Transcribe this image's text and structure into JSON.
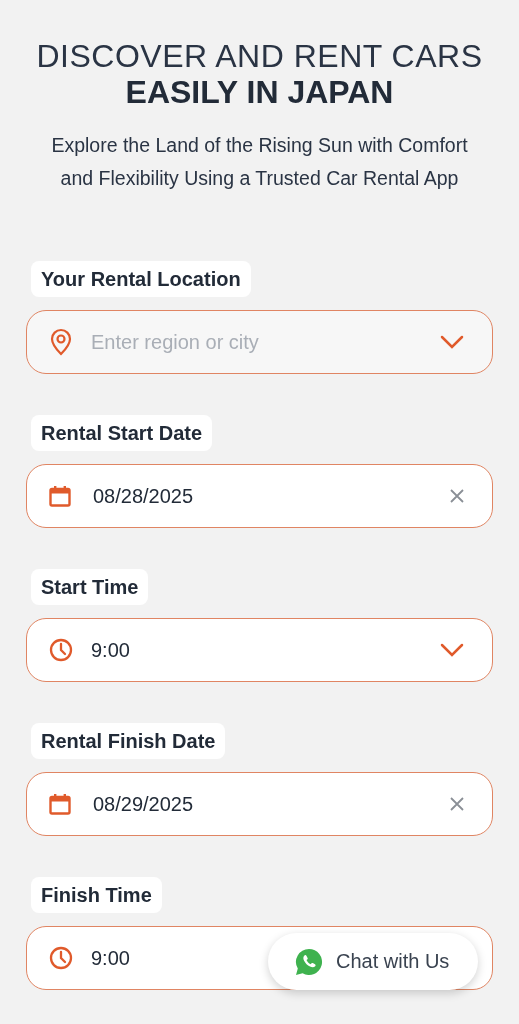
{
  "heading": {
    "line_1": "DISCOVER AND RENT CARS",
    "line_2": "EASILY IN JAPAN"
  },
  "subtitle": "Explore the Land of the Rising Sun with Comfort and Flexibility Using a Trusted Car Rental App",
  "fields": [
    {
      "kind": "location",
      "label": "Your Rental Location",
      "placeholder": "Enter region or city"
    },
    {
      "kind": "date",
      "label": "Rental Start Date",
      "value": "08/28/2025"
    },
    {
      "kind": "time",
      "label": "Start Time",
      "value": "9:00"
    },
    {
      "kind": "date",
      "label": "Rental Finish Date",
      "value": "08/29/2025"
    },
    {
      "kind": "time",
      "label": "Finish Time",
      "value": "9:00"
    }
  ],
  "chat_button": {
    "label": "Chat with Us"
  }
}
